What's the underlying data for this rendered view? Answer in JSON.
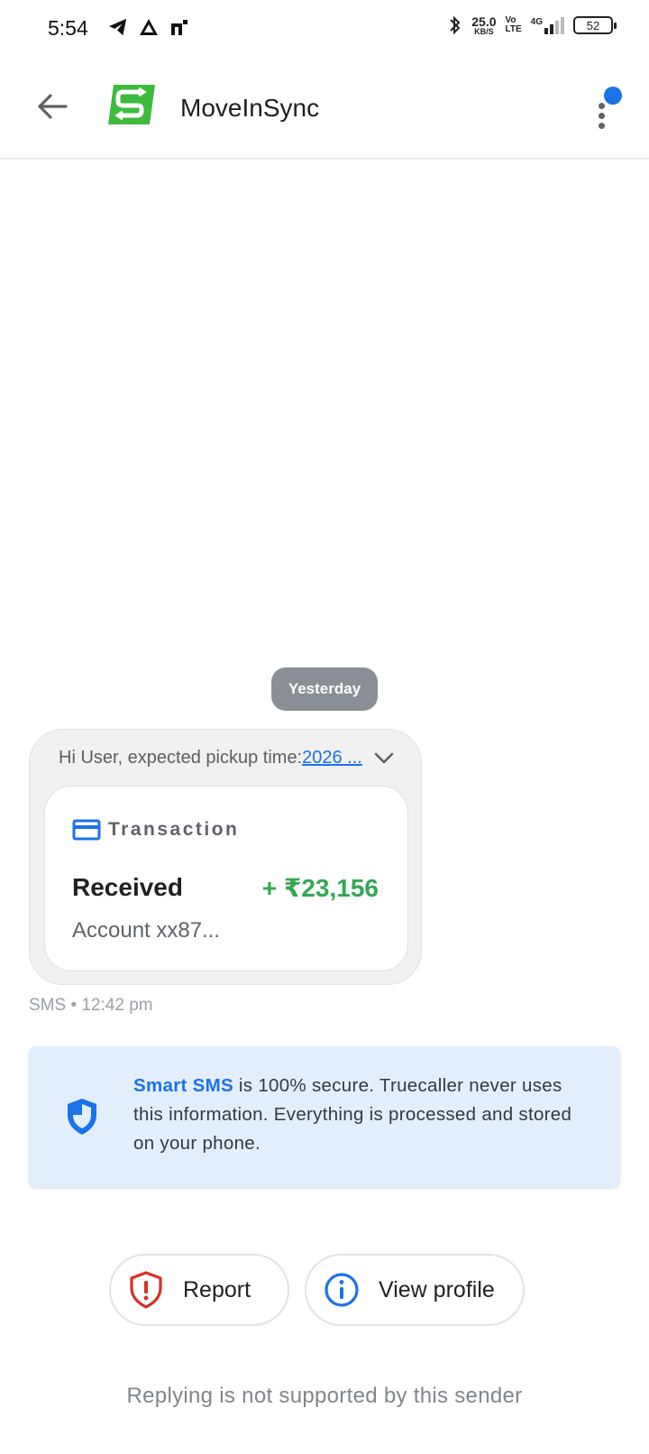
{
  "status_bar": {
    "time": "5:54",
    "net_speed_value": "25.0",
    "net_speed_unit": "KB/S",
    "volte_top": "Vo",
    "volte_bottom": "LTE",
    "network_type": "4G",
    "battery_level": "52",
    "left_icons": [
      "telegram-icon",
      "app-notification-icon",
      "app-notification-icon"
    ],
    "right_icons": [
      "bluetooth-icon",
      "signal-icon",
      "battery-icon"
    ]
  },
  "app_bar": {
    "sender_name": "MoveInSync",
    "logo_color": "#3dbb3d",
    "badge_color": "#1a73e8"
  },
  "conversation": {
    "date_chip": "Yesterday",
    "message": {
      "preview_prefix": "Hi User, expected pickup time:",
      "preview_link": "2026 ...",
      "card": {
        "type_label": "Transaction",
        "status": "Received",
        "amount": "+ ₹23,156",
        "account": "Account xx87..."
      },
      "meta": "SMS • 12:42 pm"
    }
  },
  "smart_sms": {
    "brand": "Smart SMS",
    "text": " is 100% secure. Truecaller never uses this information. Everything is processed and stored on your phone."
  },
  "actions": {
    "report_label": "Report",
    "view_profile_label": "View profile"
  },
  "footer": {
    "reply_note": "Replying is not supported by this sender"
  }
}
